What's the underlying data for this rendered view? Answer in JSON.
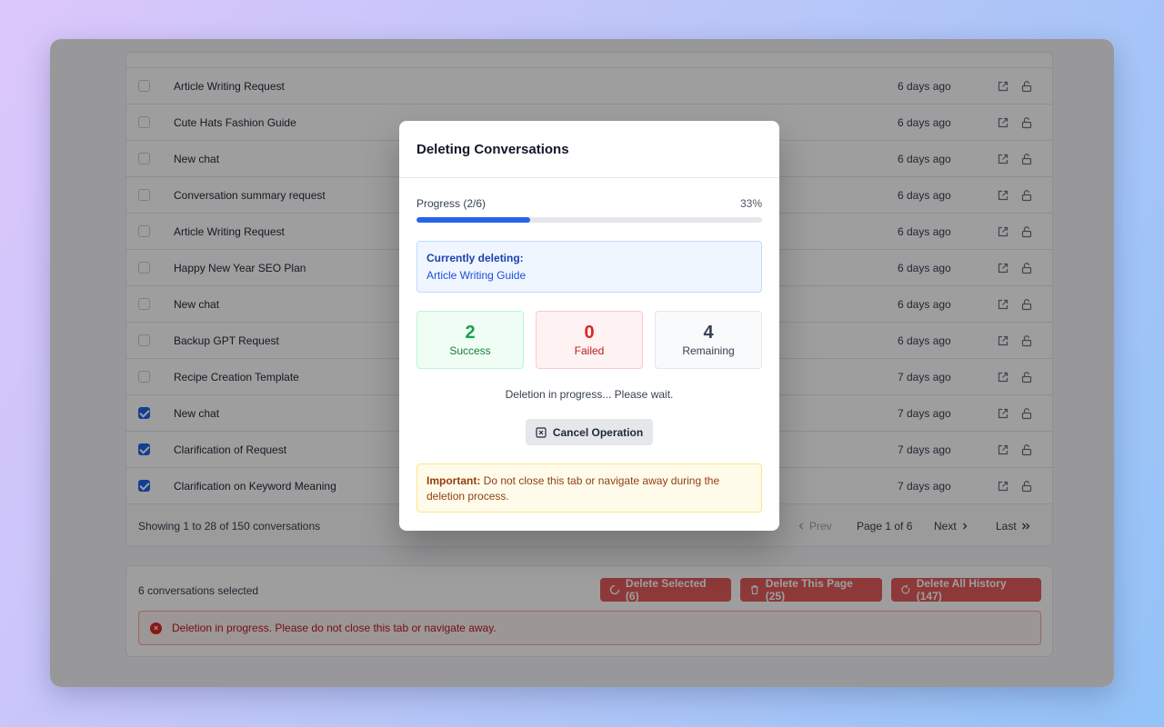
{
  "rows": [
    {
      "title": "Article Writing Request",
      "time": "6 days ago",
      "checked": false
    },
    {
      "title": "Cute Hats Fashion Guide",
      "time": "6 days ago",
      "checked": false
    },
    {
      "title": "New chat",
      "time": "6 days ago",
      "checked": false
    },
    {
      "title": "Conversation summary request",
      "time": "6 days ago",
      "checked": false
    },
    {
      "title": "Article Writing Request",
      "time": "6 days ago",
      "checked": false
    },
    {
      "title": "Happy New Year SEO Plan",
      "time": "6 days ago",
      "checked": false
    },
    {
      "title": "New chat",
      "time": "6 days ago",
      "checked": false
    },
    {
      "title": "Backup GPT Request",
      "time": "6 days ago",
      "checked": false
    },
    {
      "title": "Recipe Creation Template",
      "time": "7 days ago",
      "checked": false
    },
    {
      "title": "New chat",
      "time": "7 days ago",
      "checked": true
    },
    {
      "title": "Clarification of Request",
      "time": "7 days ago",
      "checked": true
    },
    {
      "title": "Clarification on Keyword Meaning",
      "time": "7 days ago",
      "checked": true
    }
  ],
  "footer": {
    "showing": "Showing 1 to 28 of 150 conversations",
    "prev": "Prev",
    "page": "Page 1 of 6",
    "next": "Next",
    "last": "Last"
  },
  "bulk": {
    "selected_text": "6 conversations selected",
    "delete_selected": "Delete Selected (6)",
    "delete_page": "Delete This Page (25)",
    "delete_all": "Delete All History (147)",
    "alert": "Deletion in progress. Please do not close this tab or navigate away."
  },
  "modal": {
    "title": "Deleting Conversations",
    "progress_label": "Progress (2/6)",
    "progress_percent": "33%",
    "progress_fraction": 0.33,
    "current_label": "Currently deleting:",
    "current_name": "Article Writing Guide",
    "stats": {
      "success": {
        "value": "2",
        "label": "Success"
      },
      "failed": {
        "value": "0",
        "label": "Failed"
      },
      "remaining": {
        "value": "4",
        "label": "Remaining"
      }
    },
    "wait_text": "Deletion in progress... Please wait.",
    "cancel_label": "Cancel Operation",
    "warning_strong": "Important:",
    "warning_text": " Do not close this tab or navigate away during the deletion process."
  },
  "colors": {
    "accent": "#2563eb",
    "danger": "#dc2626",
    "success": "#16a34a",
    "warning": "#92400e"
  }
}
